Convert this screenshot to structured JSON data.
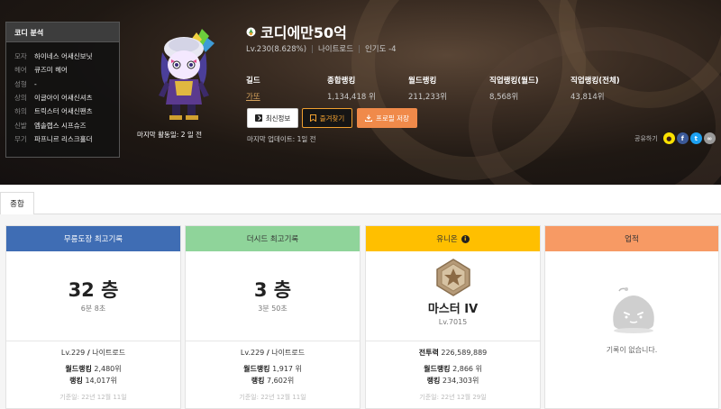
{
  "codi": {
    "title": "코디 분석",
    "items": [
      {
        "k": "모자",
        "v": "하이네스 어새신보닛"
      },
      {
        "k": "헤어",
        "v": "큐즈미 헤어"
      },
      {
        "k": "성형",
        "v": "-"
      },
      {
        "k": "상의",
        "v": "이글아이 어새신셔츠"
      },
      {
        "k": "하의",
        "v": "트릭스터 어새신팬츠"
      },
      {
        "k": "신발",
        "v": "엠솔랩스 시프슈즈"
      },
      {
        "k": "무기",
        "v": "파프니르 리스크홀더"
      }
    ]
  },
  "character": {
    "name": "코디에만50억",
    "level": "Lv.230(8.628%)",
    "job": "나이트로드",
    "popularity": "인기도 -4",
    "last_active": "마지막 활동일: 2 일 전",
    "updated": "마지막 업데이트: 1일 전"
  },
  "stats": [
    {
      "label": "길드",
      "value": "가또"
    },
    {
      "label": "종합랭킹",
      "value": "1,134,418 위"
    },
    {
      "label": "월드랭킹",
      "value": "211,233위"
    },
    {
      "label": "직업랭킹(월드)",
      "value": "8,568위"
    },
    {
      "label": "직업랭킹(전체)",
      "value": "43,814위"
    }
  ],
  "buttons": {
    "refresh": "최신정보",
    "favorite": "즐겨찾기",
    "save": "프로필 저장"
  },
  "share": {
    "label": "공유하기"
  },
  "tabs": {
    "summary": "종합"
  },
  "cards": {
    "dojang": {
      "title": "무릉도장 최고기록",
      "value": "32 층",
      "sub": "6분 8초",
      "lv": "Lv.229",
      "job": "나이트로드",
      "world_rank_label": "월드랭킹",
      "world_rank": "2,480위",
      "rank_label": "랭킹",
      "rank": "14,017위",
      "date": "기준일: 22년 12월 11일"
    },
    "seed": {
      "title": "더시드 최고기록",
      "value": "3 층",
      "sub": "3분 50초",
      "lv": "Lv.229",
      "job": "나이트로드",
      "world_rank_label": "월드랭킹",
      "world_rank": "1,917 위",
      "rank_label": "랭킹",
      "rank": "7,602위",
      "date": "기준일: 22년 12월 11일"
    },
    "union": {
      "title": "유니온",
      "grade": "마스터 IV",
      "lv": "Lv.7015",
      "power_label": "전투력",
      "power": "226,589,889",
      "world_rank_label": "월드랭킹",
      "world_rank": "2,866 위",
      "rank_label": "랭킹",
      "rank": "234,303위",
      "date": "기준일: 22년 12월 29일"
    },
    "achieve": {
      "title": "업적",
      "empty": "기록이 없습니다."
    }
  },
  "colors": {
    "dojang": "#3f6db4",
    "seed": "#8fd49a",
    "union": "#ffbf00",
    "achieve": "#f79a64"
  }
}
